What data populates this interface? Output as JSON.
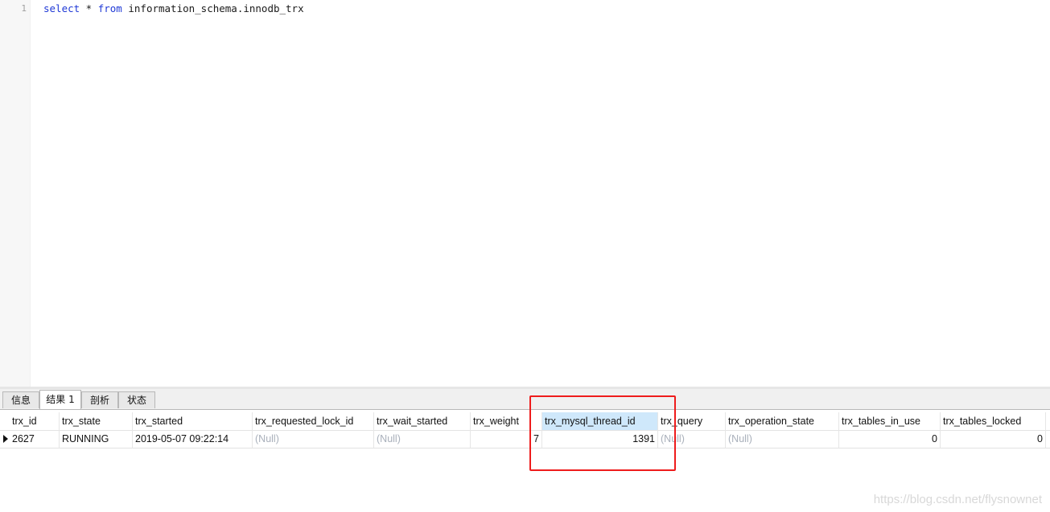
{
  "editor": {
    "line_number": "1",
    "query_select": "select",
    "query_star": " * ",
    "query_from": "from",
    "query_rest": " information_schema.innodb_trx"
  },
  "tabs": [
    {
      "label": "信息",
      "active": false
    },
    {
      "label": "结果 1",
      "active": true
    },
    {
      "label": "剖析",
      "active": false
    },
    {
      "label": "状态",
      "active": false
    }
  ],
  "grid": {
    "columns": [
      "trx_id",
      "trx_state",
      "trx_started",
      "trx_requested_lock_id",
      "trx_wait_started",
      "trx_weight",
      "trx_mysql_thread_id",
      "trx_query",
      "trx_operation_state",
      "trx_tables_in_use",
      "trx_tables_locked"
    ],
    "rows": [
      [
        "2627",
        "RUNNING",
        "2019-05-07 09:22:14",
        "(Null)",
        "(Null)",
        "7",
        "1391",
        "(Null)",
        "(Null)",
        "0",
        "0"
      ]
    ]
  },
  "colors": {
    "annotation_box": "#ee1c1c",
    "selected_header": "#cfe8fb",
    "keyword": "#1f39d6",
    "null_text": "#a9b0bb"
  },
  "watermark": "https://blog.csdn.net/flysnownet"
}
